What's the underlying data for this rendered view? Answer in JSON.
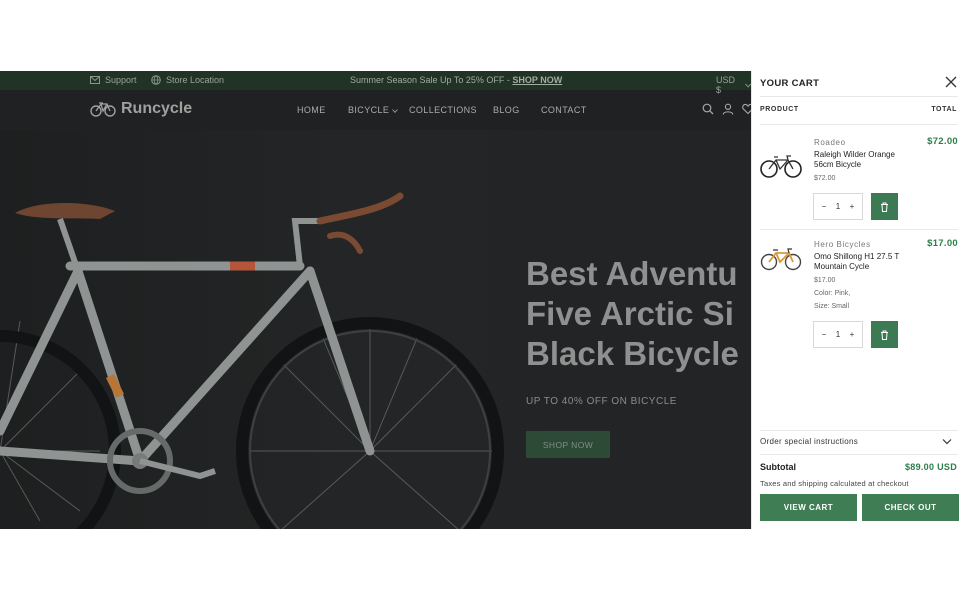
{
  "announcement": {
    "support": "Support",
    "store_location": "Store Location",
    "promo_text": "Summer Season Sale Up To 25% OFF - ",
    "promo_link": "SHOP NOW",
    "currency": "USD $"
  },
  "header": {
    "logo": "Runcycle",
    "nav": [
      "HOME",
      "BICYCLE",
      "COLLECTIONS",
      "BLOG",
      "CONTACT"
    ]
  },
  "hero": {
    "title_lines": [
      "Best Adventu",
      "Five Arctic Si",
      "Black Bicycle"
    ],
    "subtitle": "UP TO 40% OFF ON BICYCLE",
    "button": "SHOP NOW"
  },
  "cart": {
    "title": "YOUR CART",
    "col_product": "PRODUCT",
    "col_total": "TOTAL",
    "items": [
      {
        "vendor": "Roadeo",
        "name": "Raleigh Wilder Orange 56cm Bicycle",
        "unit_price": "$72.00",
        "options": [],
        "quantity": "1",
        "total": "$72.00"
      },
      {
        "vendor": "Hero Bicycles",
        "name": "Omo Shillong H1 27.5 T Mountain Cycle",
        "unit_price": "$17.00",
        "options": [
          "Color: Pink,",
          "Size: Small"
        ],
        "quantity": "1",
        "total": "$17.00"
      }
    ],
    "instructions_label": "Order special instructions",
    "subtotal_label": "Subtotal",
    "subtotal_value": "$89.00 USD",
    "tax_note": "Taxes and shipping calculated at checkout",
    "view_cart": "VIEW CART",
    "check_out": "CHECK OUT"
  },
  "colors": {
    "accent_green": "#3f7d55",
    "price_green": "#2e7d4a",
    "announcement_bar": "#213325"
  }
}
